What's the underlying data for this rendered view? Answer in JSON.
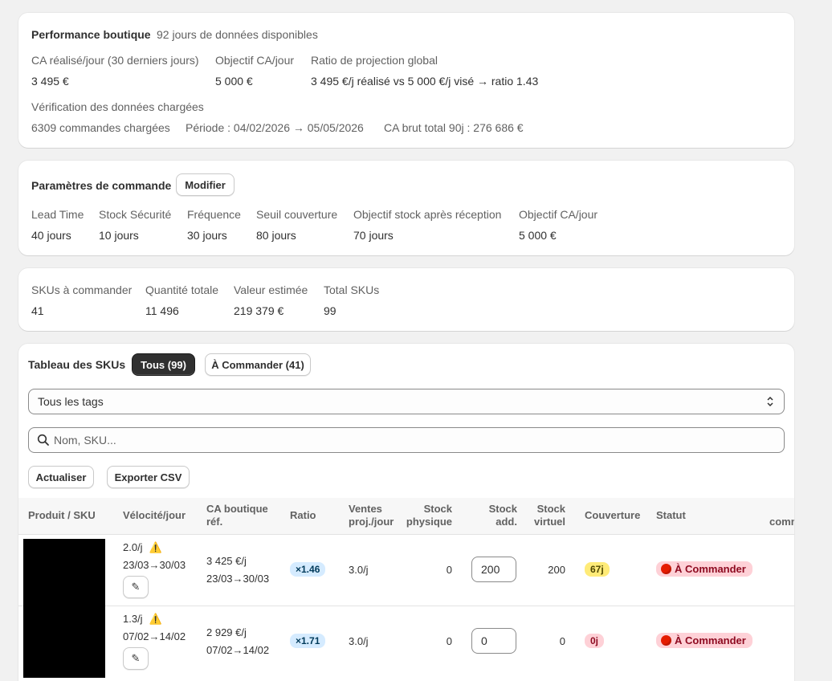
{
  "perf": {
    "title": "Performance boutique",
    "days_info": "92 jours de données disponibles",
    "ca_label": "CA réalisé/jour (30 derniers jours)",
    "ca_value": "3 495 €",
    "obj_label": "Objectif CA/jour",
    "obj_value": "5 000 €",
    "ratio_label": "Ratio de projection global",
    "ratio_value": "3 495 €/j réalisé vs 5 000 €/j visé → ratio 1.43",
    "verif_label": "Vérification des données chargées",
    "orders": "6309 commandes chargées",
    "period": "Période : 04/02/2026 → 05/05/2026",
    "ca_total": "CA brut total 90j : 276 686 €"
  },
  "params": {
    "title": "Paramètres de commande",
    "edit_label": "Modifier",
    "items": [
      {
        "label": "Lead Time",
        "value": "40 jours"
      },
      {
        "label": "Stock Sécurité",
        "value": "10 jours"
      },
      {
        "label": "Fréquence",
        "value": "30 jours"
      },
      {
        "label": "Seuil couverture",
        "value": "80 jours"
      },
      {
        "label": "Objectif stock après réception",
        "value": "70 jours"
      },
      {
        "label": "Objectif CA/jour",
        "value": "5 000 €"
      }
    ]
  },
  "summary": {
    "items": [
      {
        "label": "SKUs à commander",
        "value": "41"
      },
      {
        "label": "Quantité totale",
        "value": "11 496"
      },
      {
        "label": "Valeur estimée",
        "value": "219 379 €"
      },
      {
        "label": "Total SKUs",
        "value": "99"
      }
    ]
  },
  "table": {
    "title": "Tableau des SKUs",
    "tab_all": "Tous (99)",
    "tab_order": "À Commander (41)",
    "tag_select": "Tous les tags",
    "search_placeholder": "Nom, SKU...",
    "refresh_label": "Actualiser",
    "export_label": "Exporter CSV",
    "headers": {
      "product": "Produit / SKU",
      "velocity": "Vélocité/jour",
      "ca_line1": "CA boutique",
      "ca_line2": "réf.",
      "ratio": "Ratio",
      "sales_line1": "Ventes",
      "sales_line2": "proj./jour",
      "phys_line1": "Stock",
      "phys_line2": "physique",
      "add_line1": "Stock",
      "add_line2": "add.",
      "virt_line1": "Stock",
      "virt_line2": "virtuel",
      "coverage": "Couverture",
      "status": "Statut",
      "extra": "comm"
    },
    "rows": [
      {
        "velocity": "2.0/j",
        "velocity_period": "23/03→30/03",
        "ca": "3 425 €/j",
        "ca_period": "23/03→30/03",
        "ratio": "×1.46",
        "sales": "3.0/j",
        "stock_phys": "0",
        "stock_add": "200",
        "stock_virt": "200",
        "coverage": "67j",
        "coverage_color": "#ffeb78",
        "status": "À Commander"
      },
      {
        "velocity": "1.3/j",
        "velocity_period": "07/02→14/02",
        "ca": "2 929 €/j",
        "ca_period": "07/02→14/02",
        "ratio": "×1.71",
        "sales": "3.0/j",
        "stock_phys": "0",
        "stock_add": "0",
        "stock_virt": "0",
        "coverage": "0j",
        "coverage_color": "#fed1d7",
        "status": "À Commander"
      }
    ]
  },
  "icons": {
    "warning": "⚠️",
    "pencil": "✎",
    "search": "search-icon",
    "select": "chevron-up-down-icon"
  }
}
